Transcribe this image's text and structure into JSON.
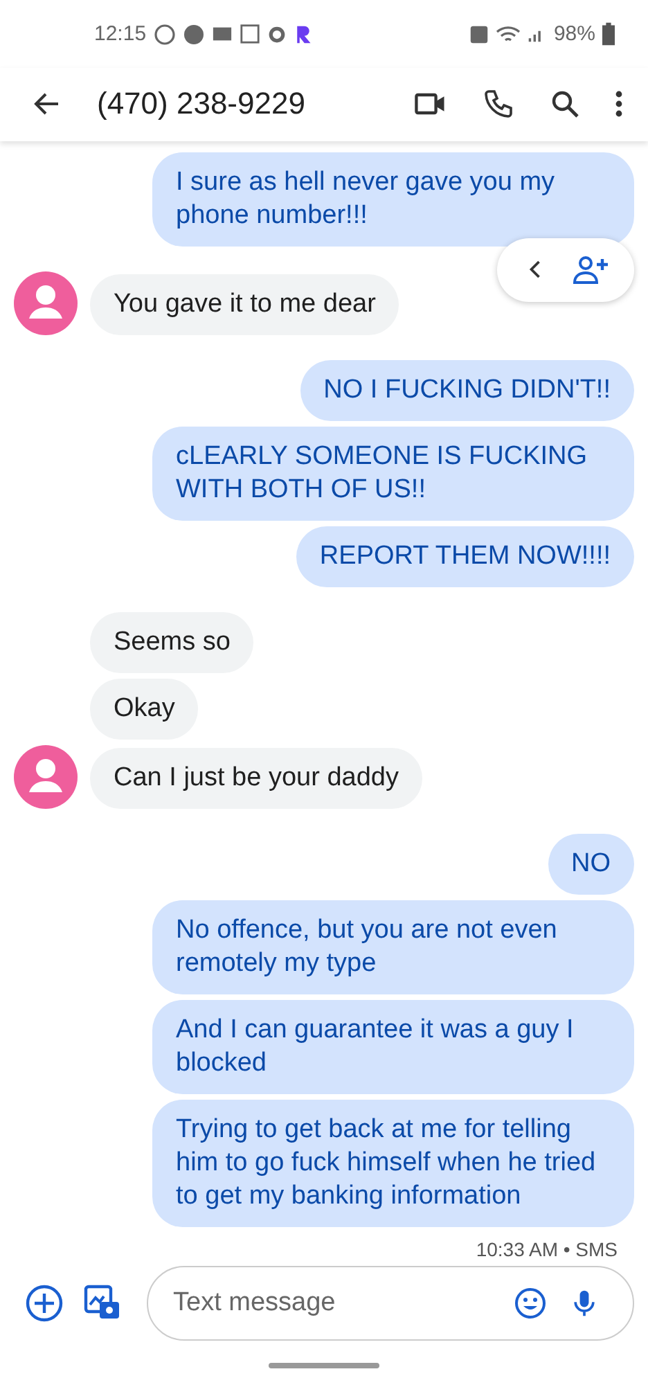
{
  "status_bar": {
    "time": "12:15",
    "battery": "98%"
  },
  "header": {
    "title": "(470) 238-9229"
  },
  "messages": [
    {
      "kind": "sent",
      "text": "I sure as hell never gave you my phone number!!!"
    },
    {
      "kind": "received",
      "text": "You gave it to me dear",
      "avatar": true
    },
    {
      "kind": "sent",
      "text": "NO I FUCKING DIDN'T!!"
    },
    {
      "kind": "sent",
      "text": "cLEARLY SOMEONE IS FUCKING WITH BOTH OF US!!"
    },
    {
      "kind": "sent",
      "text": "REPORT THEM NOW!!!!"
    },
    {
      "kind": "received",
      "text": "Seems so",
      "avatar": false
    },
    {
      "kind": "received",
      "text": "Okay",
      "avatar": false
    },
    {
      "kind": "received",
      "text": "Can I just be your daddy",
      "avatar": true
    },
    {
      "kind": "sent",
      "text": "NO"
    },
    {
      "kind": "sent",
      "text": "No offence, but you are not even remotely my type"
    },
    {
      "kind": "sent",
      "text": "And I can guarantee it was a guy I blocked"
    },
    {
      "kind": "sent",
      "text": "Trying to get back at me for telling him to go fuck himself when he tried to get my banking information"
    }
  ],
  "timestamp": "10:33 AM • SMS",
  "composer": {
    "placeholder": "Text message"
  }
}
